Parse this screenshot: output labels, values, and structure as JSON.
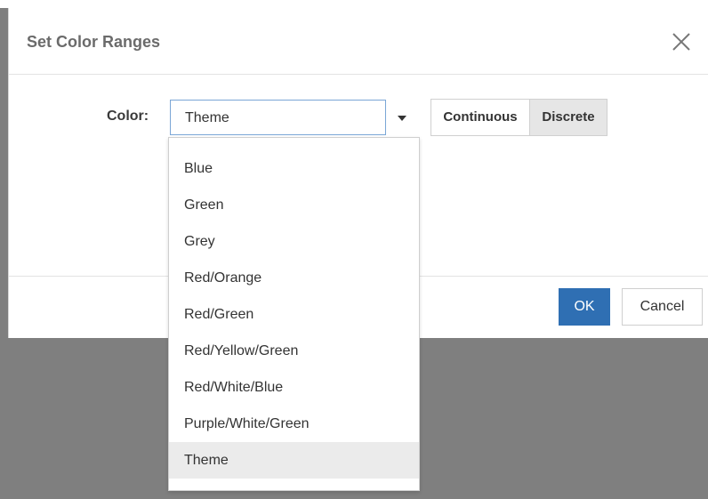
{
  "dialog": {
    "title": "Set Color Ranges",
    "color_label": "Color:",
    "selected_value": "Theme",
    "mode_buttons": {
      "continuous": "Continuous",
      "discrete": "Discrete"
    },
    "footer": {
      "ok": "OK",
      "cancel": "Cancel"
    }
  },
  "dropdown": {
    "options": [
      "Blue",
      "Green",
      "Grey",
      "Red/Orange",
      "Red/Green",
      "Red/Yellow/Green",
      "Red/White/Blue",
      "Purple/White/Green",
      "Theme"
    ],
    "highlighted": "Theme"
  },
  "colors": {
    "accent": "#2f6fb3",
    "overlay": "#7f7f7f"
  },
  "icons": {
    "close": "close-icon",
    "caret": "chevron-down-icon"
  }
}
